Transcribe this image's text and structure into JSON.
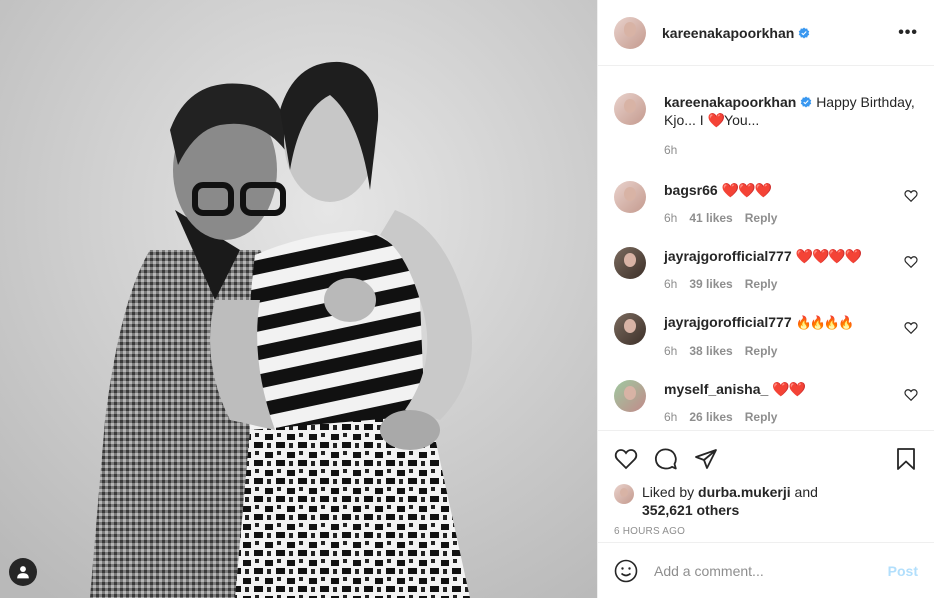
{
  "header": {
    "username": "kareenakapoorkhan",
    "more_label": "•••"
  },
  "caption": {
    "username": "kareenakapoorkhan",
    "text_before": "Happy Birthday, Kjo... I ",
    "heart": "❤️",
    "text_after": "You...",
    "time": "6h"
  },
  "comments": [
    {
      "username": "bagsr66",
      "text": "❤️❤️❤️",
      "time": "6h",
      "likes": "41 likes",
      "reply": "Reply"
    },
    {
      "username": "jayrajgorofficial777",
      "text": "❤️❤️❤️❤️",
      "time": "6h",
      "likes": "39 likes",
      "reply": "Reply"
    },
    {
      "username": "jayrajgorofficial777",
      "text": "🔥🔥🔥🔥",
      "time": "6h",
      "likes": "38 likes",
      "reply": "Reply"
    },
    {
      "username": "myself_anisha_",
      "text": "❤️❤️",
      "time": "6h",
      "likes": "26 likes",
      "reply": "Reply"
    }
  ],
  "likes": {
    "prefix": "Liked by ",
    "user": "durba.mukerji",
    "middle": " and",
    "count": "352,621 others"
  },
  "timeago": "6 HOURS AGO",
  "add_comment": {
    "placeholder": "Add a comment...",
    "post_label": "Post"
  },
  "colors": {
    "verified": "#3897f0",
    "post_disabled": "#b2dffc",
    "meta_gray": "#8e8e8e"
  }
}
